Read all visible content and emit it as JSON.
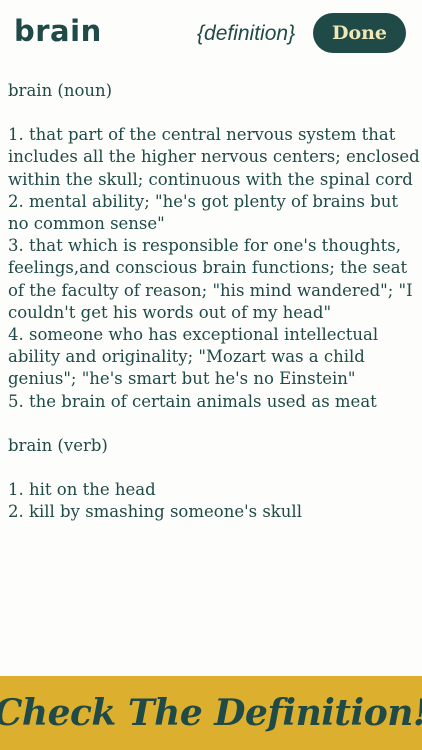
{
  "header": {
    "word": "brain",
    "mode_label": "{definition}",
    "done_label": "Done"
  },
  "definitions": [
    {
      "heading": "brain (noun)",
      "senses": [
        "1. that part of the central nervous system that includes all the higher nervous centers; enclosed within the skull; continuous with the spinal cord",
        "2. mental ability; \"he's got plenty of brains but no common sense\"",
        "3. that which is responsible for one's thoughts, feelings,and conscious brain functions; the seat of the faculty of reason; \"his mind wandered\"; \"I couldn't get his words out of my head\"",
        "4. someone who has exceptional intellectual ability and originality; \"Mozart was a child genius\"; \"he's smart but he's no Einstein\"",
        "5. the brain of certain animals used as meat"
      ]
    },
    {
      "heading": "brain (verb)",
      "senses": [
        "1. hit on the head",
        "2. kill by smashing someone's skull"
      ]
    }
  ],
  "banner": {
    "text": "Check The Definition!"
  },
  "colors": {
    "primary": "#1f4a47",
    "accent": "#dcb02e",
    "button_text": "#f0e7b6",
    "background": "#fdfdfb"
  }
}
